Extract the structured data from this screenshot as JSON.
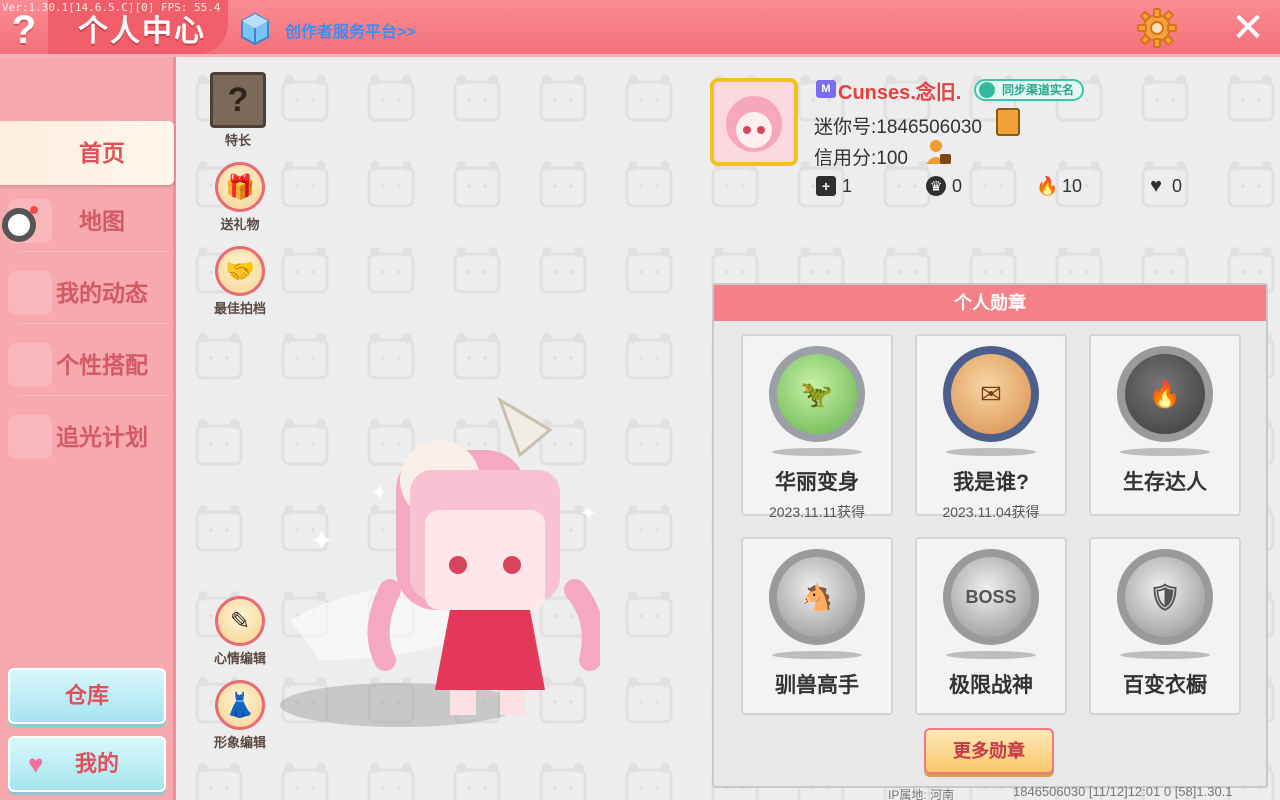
{
  "version_text": "Ver:1.30.1[14.6.5.C][0] FPS: 55.4",
  "header": {
    "help_label": "?",
    "title": "个人中心",
    "creator_link": "创作者服务平台>>",
    "close_label": "✕"
  },
  "sidebar": {
    "items": [
      {
        "label": "首页"
      },
      {
        "label": "地图"
      },
      {
        "label": "我的动态"
      },
      {
        "label": "个性搭配"
      },
      {
        "label": "追光计划"
      }
    ],
    "warehouse_label": "仓库",
    "mine_label": "我的"
  },
  "actions": {
    "speciality": "特长",
    "send_gift": "送礼物",
    "best_partner": "最佳拍档",
    "mood_edit": "心情编辑",
    "image_edit": "形象编辑"
  },
  "profile": {
    "vip_badge": "M",
    "nickname": "Cunses.念旧.",
    "realname_badge": "同步渠道实名",
    "uid": "迷你号:1846506030",
    "credit": "信用分:100",
    "stats": [
      {
        "icon": "add-friend-icon",
        "value": "1"
      },
      {
        "icon": "fans-icon",
        "value": "0"
      },
      {
        "icon": "flame-icon",
        "value": "10"
      },
      {
        "icon": "heart-icon",
        "value": "0"
      }
    ]
  },
  "medals": {
    "title": "个人勋章",
    "items": [
      {
        "name": "华丽变身",
        "date": "2023.11.11获得",
        "icon": "dino-medal-icon"
      },
      {
        "name": "我是谁?",
        "date": "2023.11.04获得",
        "icon": "letter-medal-icon"
      },
      {
        "name": "生存达人",
        "date": "",
        "icon": "fire-medal-icon"
      },
      {
        "name": "驯兽高手",
        "date": "",
        "icon": "horse-medal-icon"
      },
      {
        "name": "极限战神",
        "date": "",
        "icon": "boss-medal-icon"
      },
      {
        "name": "百变衣橱",
        "date": "",
        "icon": "wardrobe-medal-icon"
      }
    ],
    "boss_text": "BOSS",
    "more_label": "更多勋章"
  },
  "footer": {
    "ip": "IP属地: 河南",
    "info": "1846506030    [11/12]12:01 0   [58]1.30.1"
  },
  "colors": {
    "brand_pink": "#f4707a",
    "sidebar_pink": "#f7a9ad",
    "link_blue": "#3b8df1",
    "nickname_red": "#e64040"
  }
}
